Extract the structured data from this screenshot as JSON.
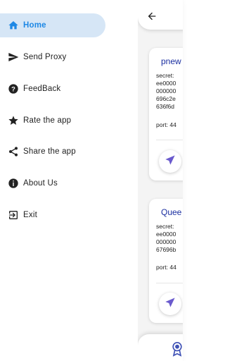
{
  "drawer": {
    "items": [
      {
        "label": "Home",
        "icon": "home-icon",
        "active": true
      },
      {
        "label": "Send Proxy",
        "icon": "send-icon"
      },
      {
        "label": "FeedBack",
        "icon": "help-icon"
      },
      {
        "label": "Rate the app",
        "icon": "star-icon"
      },
      {
        "label": "Share the app",
        "icon": "share-icon"
      },
      {
        "label": "About Us",
        "icon": "info-icon"
      },
      {
        "label": "Exit",
        "icon": "exit-icon"
      }
    ]
  },
  "main": {
    "cards": [
      {
        "title": "pnew",
        "secret_label": "secret:",
        "secret_lines": [
          "ee0000",
          "000000",
          "696c2e",
          "636f6d"
        ],
        "port": "port: 44"
      },
      {
        "title": "Quee",
        "secret_label": "secret:",
        "secret_lines": [
          "ee0000",
          "000000",
          "67696b"
        ],
        "port": "port: 44"
      }
    ]
  },
  "colors": {
    "accent": "#1e88e5",
    "active_bg": "#d6e6f6",
    "card_title": "#1a2ea0",
    "send_icon": "#6a5acd"
  }
}
